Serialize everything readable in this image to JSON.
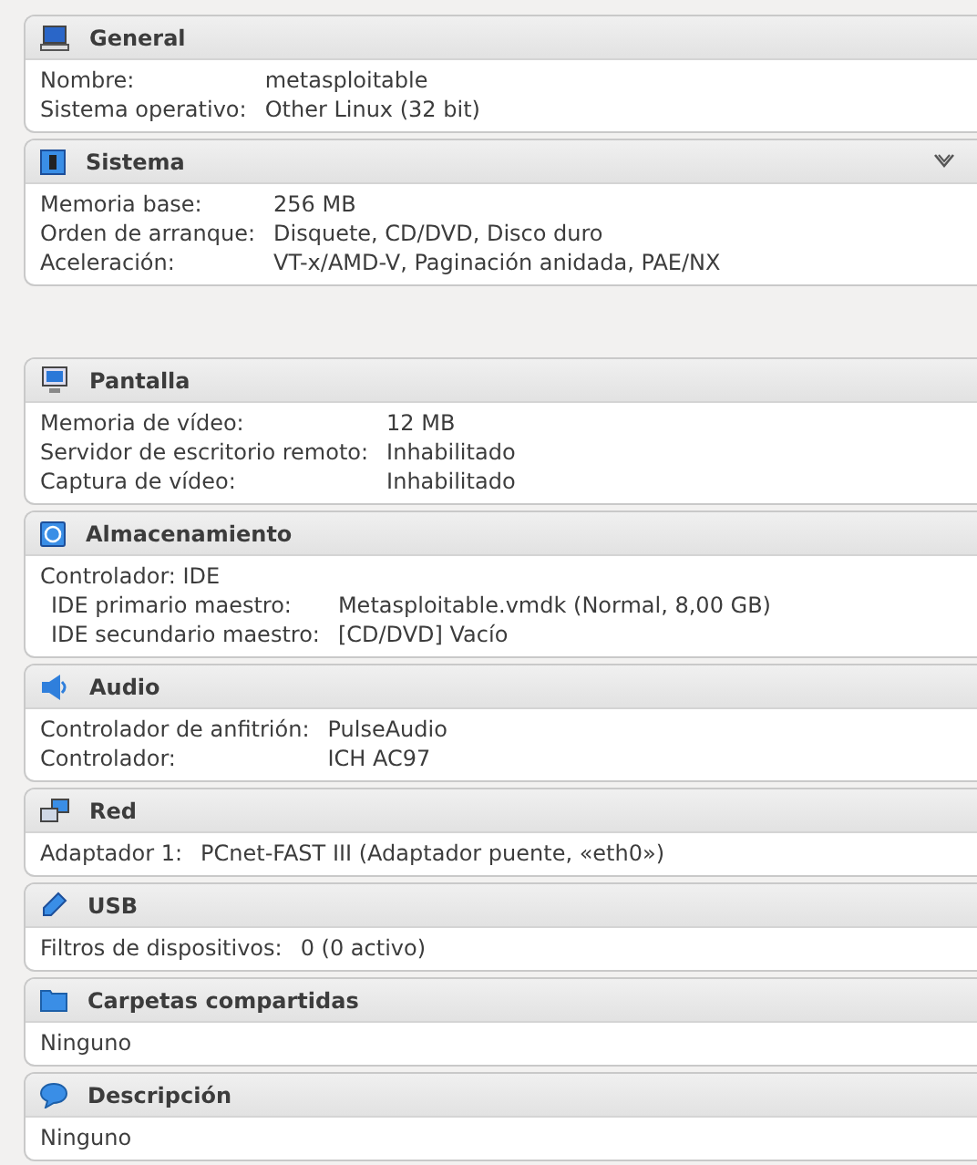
{
  "sections": [
    {
      "title": "General",
      "collapse_toggle": false,
      "rows": [
        {
          "kind": "pair",
          "label": "Nombre:",
          "value": "metasploitable"
        },
        {
          "kind": "pair",
          "label": "Sistema operativo:",
          "value": "Other Linux (32 bit)"
        }
      ]
    },
    {
      "title": "Sistema",
      "collapse_toggle": true,
      "rows": [
        {
          "kind": "pair",
          "label": "Memoria base:",
          "value": "256 MB"
        },
        {
          "kind": "pair",
          "label": "Orden de arranque:",
          "value": "Disquete, CD/DVD, Disco duro"
        },
        {
          "kind": "pair",
          "label": "Aceleración:",
          "value": "VT-x/AMD-V, Paginación anidada, PAE/NX"
        }
      ]
    },
    {
      "title": "Pantalla",
      "collapse_toggle": false,
      "rows": [
        {
          "kind": "pair",
          "label": "Memoria de vídeo:",
          "value": "12 MB"
        },
        {
          "kind": "pair",
          "label": "Servidor de escritorio remoto:",
          "value": "Inhabilitado"
        },
        {
          "kind": "pair",
          "label": "Captura de vídeo:",
          "value": "Inhabilitado"
        }
      ]
    },
    {
      "title": "Almacenamiento",
      "collapse_toggle": false,
      "rows": [
        {
          "kind": "heading",
          "label": "Controlador: IDE"
        },
        {
          "kind": "indented",
          "label": "IDE primario maestro:",
          "value": "Metasploitable.vmdk (Normal, 8,00 GB)"
        },
        {
          "kind": "indented",
          "label": "IDE secundario maestro:",
          "value": "[CD/DVD] Vacío"
        }
      ]
    },
    {
      "title": "Audio",
      "collapse_toggle": false,
      "rows": [
        {
          "kind": "pair",
          "label": "Controlador de anfitrión:",
          "value": "PulseAudio"
        },
        {
          "kind": "pair",
          "label": "Controlador:",
          "value": "ICH AC97"
        }
      ]
    },
    {
      "title": "Red",
      "collapse_toggle": false,
      "rows": [
        {
          "kind": "pair",
          "label": "Adaptador 1:",
          "value": "PCnet-FAST III (Adaptador puente, «eth0»)"
        }
      ]
    },
    {
      "title": "USB",
      "collapse_toggle": false,
      "rows": [
        {
          "kind": "pair",
          "label": "Filtros de dispositivos:",
          "value": "0 (0 activo)"
        }
      ]
    },
    {
      "title": "Carpetas compartidas",
      "collapse_toggle": false,
      "rows": [
        {
          "kind": "heading",
          "label": "Ninguno"
        }
      ]
    },
    {
      "title": "Descripción",
      "collapse_toggle": false,
      "rows": [
        {
          "kind": "heading",
          "label": "Ninguno"
        }
      ]
    }
  ]
}
